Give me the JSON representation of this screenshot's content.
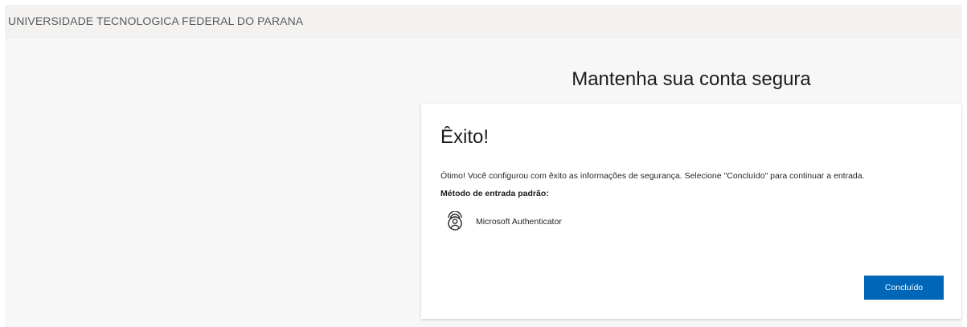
{
  "header": {
    "org_name": "UNIVERSIDADE TECNOLOGICA FEDERAL DO PARANA"
  },
  "page": {
    "title": "Mantenha sua conta segura"
  },
  "card": {
    "title": "Êxito!",
    "message": "Ótimo! Você configurou com êxito as informações de segurança. Selecione \"Concluído\" para continuar a entrada.",
    "method_heading": "Método de entrada padrão:",
    "method": {
      "icon": "authenticator-app-icon",
      "label": "Microsoft Authenticator"
    },
    "done_label": "Concluído"
  },
  "colors": {
    "accent": "#0067b8",
    "header_bg": "#f3f2f1",
    "card_bg": "#ffffff"
  }
}
